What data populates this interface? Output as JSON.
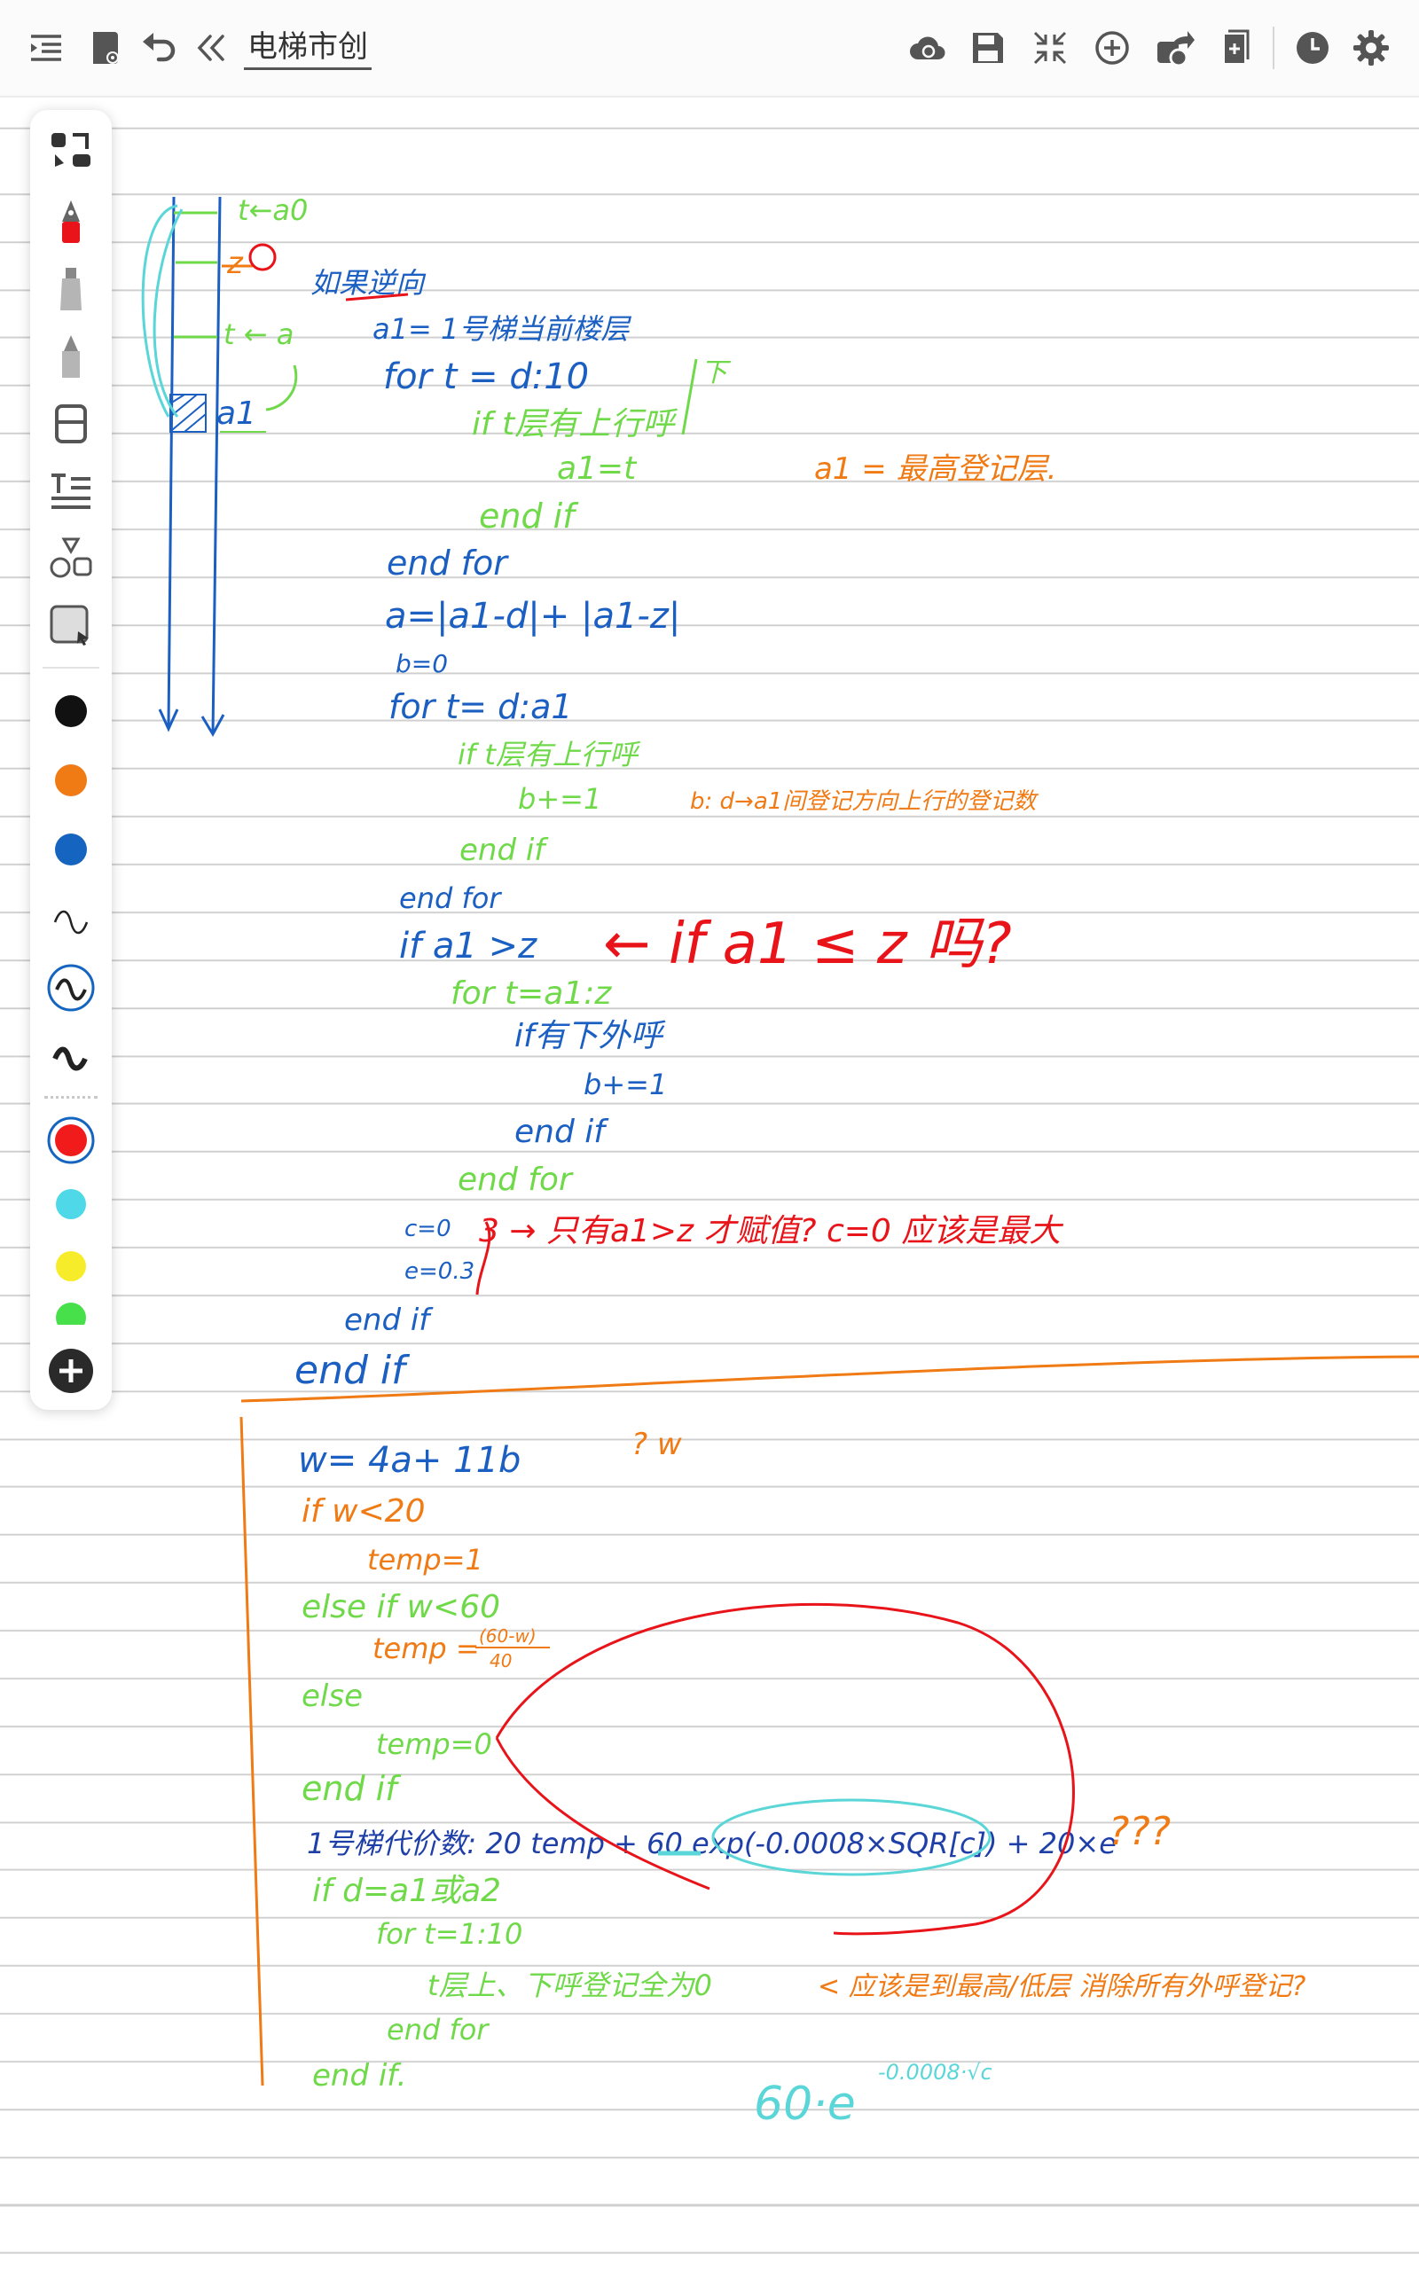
{
  "app": {
    "title": "电梯市创"
  },
  "toolbar": {
    "left_icons": [
      "outline-icon",
      "notebook-icon",
      "undo-icon",
      "collapse-left-icon"
    ],
    "right_icons": [
      "cloud-sync-icon",
      "save-icon",
      "fullscreen-exit-icon",
      "add-circle-icon",
      "share-icon",
      "add-page-icon",
      "history-icon",
      "settings-icon"
    ]
  },
  "palette": {
    "tools": [
      "lasso-icon",
      "fountain-pen-icon",
      "highlighter-icon",
      "pencil-icon",
      "eraser-icon",
      "text-icon",
      "shapes-icon",
      "select-image-icon"
    ],
    "colors": {
      "black": "#111111",
      "orange": "#f07a14",
      "blue": "#1565c0",
      "red": "#f21b1b",
      "cyan": "#4fd8e8",
      "yellow": "#f7ec2a",
      "green": "#48e04a"
    },
    "selected_color": "red",
    "strokes": [
      "stroke-thin-icon",
      "stroke-medium-icon",
      "stroke-thick-icon"
    ],
    "selected_stroke": "stroke-medium-icon",
    "add_label": "+"
  },
  "ink_colors": {
    "blue": "#1a5fc1",
    "green": "#6fd94a",
    "orange": "#f07a14",
    "red": "#e8141a",
    "cyan": "#5ad6d8",
    "navy": "#1f3fa8"
  },
  "notes": {
    "diagram": {
      "top_right": "t←a0",
      "z": "z",
      "t_a": "t ← a",
      "a1": "a1",
      "heading": "如果逆向"
    },
    "code1": [
      "a1= 1号梯当前楼层",
      "for  t = d:10",
      "if  t层有上行呼",
      "a1=t",
      "end  if",
      "end  for",
      "a=|a1-d|+ |a1-z|",
      "b=0",
      "for t= d:a1",
      "if  t层有上行呼",
      "b+=1",
      "end if",
      "end  for",
      "if  a1 >z",
      "for  t=a1:z",
      "if有下外呼",
      "b+=1",
      "end if",
      "end for",
      "c=0",
      "e=0.3",
      "end  if",
      "end  if"
    ],
    "annotations": {
      "down": "下",
      "a1_max": "a1 = 最高登记层.",
      "b_count": "b: d→a1间登记方向上行的登记数",
      "question": "←  if  a1 ≤ z 吗?",
      "c_question": "3 → 只有a1>z 才赋值? c=0 应该是最大",
      "w_question": "? w",
      "qqq": "???",
      "should_reset": "<  应该是到最高/低层 消除所有外呼登记?"
    },
    "code2": [
      "w= 4a+ 11b",
      "if   w<20",
      "temp=1",
      "else  if   w<60",
      "temp =",
      "(60-w)",
      "40",
      "else",
      "temp=0",
      "end if",
      "1号梯代价数: 20 temp  + 60  exp(-0.0008×SQR[c]) + 20×e",
      "if   d=a1或a2",
      "for   t=1:10",
      "t层上、下呼登记全为0",
      "end  for",
      "end if."
    ],
    "formula": "60·e",
    "formula_exp": "-0.0008·√c"
  }
}
